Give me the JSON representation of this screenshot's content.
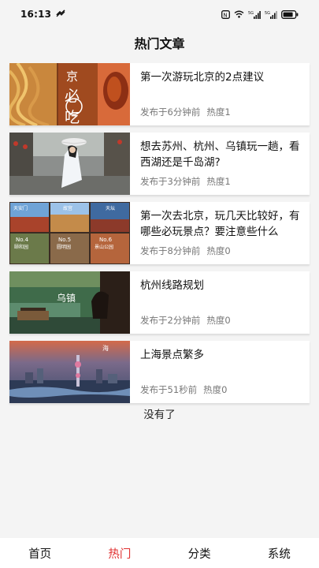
{
  "status_bar": {
    "time": "16:13",
    "network": "5G"
  },
  "header": {
    "title": "热门文章"
  },
  "articles": [
    {
      "title": "第一次游玩北京的2点建议",
      "published": "发布于6分钟前",
      "heat": "热度1",
      "thumb_text": "京必吃"
    },
    {
      "title": "想去苏州、杭州、乌镇玩一趟，看西湖还是千岛湖?",
      "published": "发布于3分钟前",
      "heat": "热度1",
      "thumb_text": ""
    },
    {
      "title": "第一次去北京，玩几天比较好，有哪些必玩景点？要注意些什么",
      "published": "发布于8分钟前",
      "heat": "热度0",
      "thumb_text": "天安门 故宫 天坛 No.4 颐和园 No.5 圆明园 No.6 景山公园"
    },
    {
      "title": "杭州线路规划",
      "published": "发布于2分钟前",
      "heat": "热度0",
      "thumb_text": "乌镇"
    },
    {
      "title": "上海景点繁多",
      "published": "发布于51秒前",
      "heat": "热度0",
      "thumb_text": ""
    }
  ],
  "list_end": "没有了",
  "tabs": [
    {
      "label": "首页",
      "active": false
    },
    {
      "label": "热门",
      "active": true
    },
    {
      "label": "分类",
      "active": false
    },
    {
      "label": "系统",
      "active": false
    }
  ],
  "colors": {
    "accent": "#e03131",
    "background": "#f4f4f4"
  }
}
